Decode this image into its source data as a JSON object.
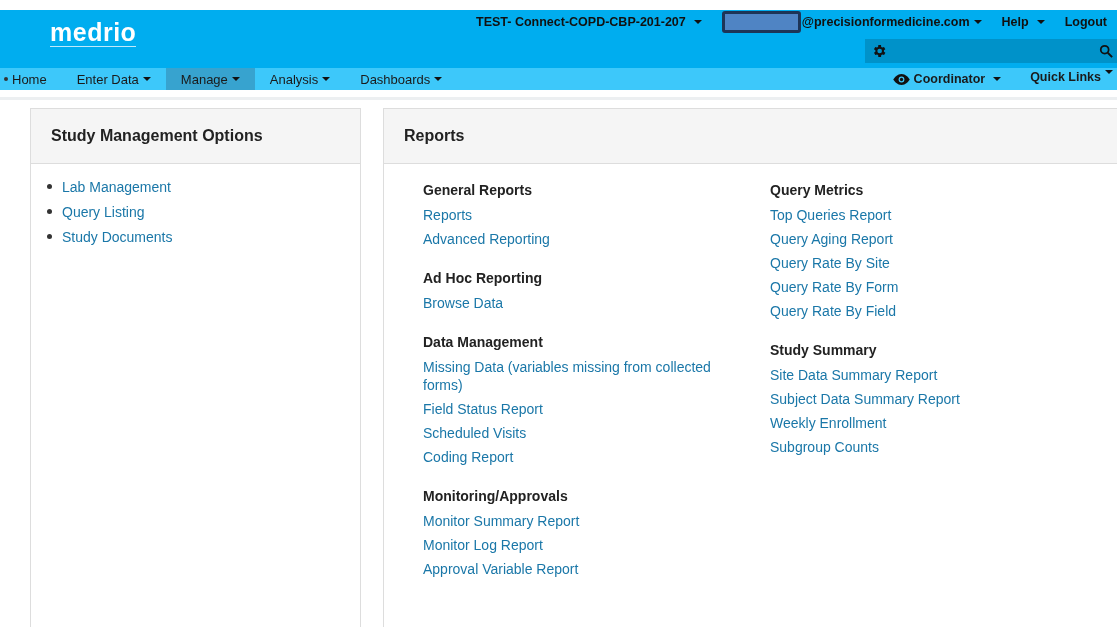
{
  "header": {
    "logo": "medrio",
    "study": "TEST- Connect-COPD-CBP-201-207",
    "user_email": "@precisionformedicine.com",
    "user_redacted": true,
    "help": "Help",
    "logout": "Logout"
  },
  "nav": {
    "items": [
      {
        "label": "Home",
        "selected": false,
        "dropdown": false
      },
      {
        "label": "Enter Data",
        "selected": false,
        "dropdown": true
      },
      {
        "label": "Manage",
        "selected": true,
        "dropdown": true
      },
      {
        "label": "Analysis",
        "selected": false,
        "dropdown": true
      },
      {
        "label": "Dashboards",
        "selected": false,
        "dropdown": true
      }
    ],
    "role": "Coordinator",
    "quick_links": "Quick Links"
  },
  "study_management": {
    "title": "Study Management Options",
    "items": [
      "Lab Management",
      "Query Listing",
      "Study Documents"
    ]
  },
  "reports": {
    "title": "Reports",
    "columns": [
      [
        {
          "heading": "General Reports",
          "links": [
            "Reports",
            "Advanced Reporting"
          ]
        },
        {
          "heading": "Ad Hoc Reporting",
          "links": [
            "Browse Data"
          ]
        },
        {
          "heading": "Data Management",
          "links": [
            "Missing Data (variables missing from collected forms)",
            "Field Status Report",
            "Scheduled Visits",
            "Coding Report"
          ]
        },
        {
          "heading": "Monitoring/Approvals",
          "links": [
            "Monitor Summary Report",
            "Monitor Log Report",
            "Approval Variable Report"
          ]
        }
      ],
      [
        {
          "heading": "Query Metrics",
          "links": [
            "Top Queries Report",
            "Query Aging Report",
            "Query Rate By Site",
            "Query Rate By Form",
            "Query Rate By Field"
          ]
        },
        {
          "heading": "Study Summary",
          "links": [
            "Site Data Summary Report",
            "Subject Data Summary Report",
            "Weekly Enrollment",
            "Subgroup Counts"
          ]
        }
      ]
    ]
  }
}
